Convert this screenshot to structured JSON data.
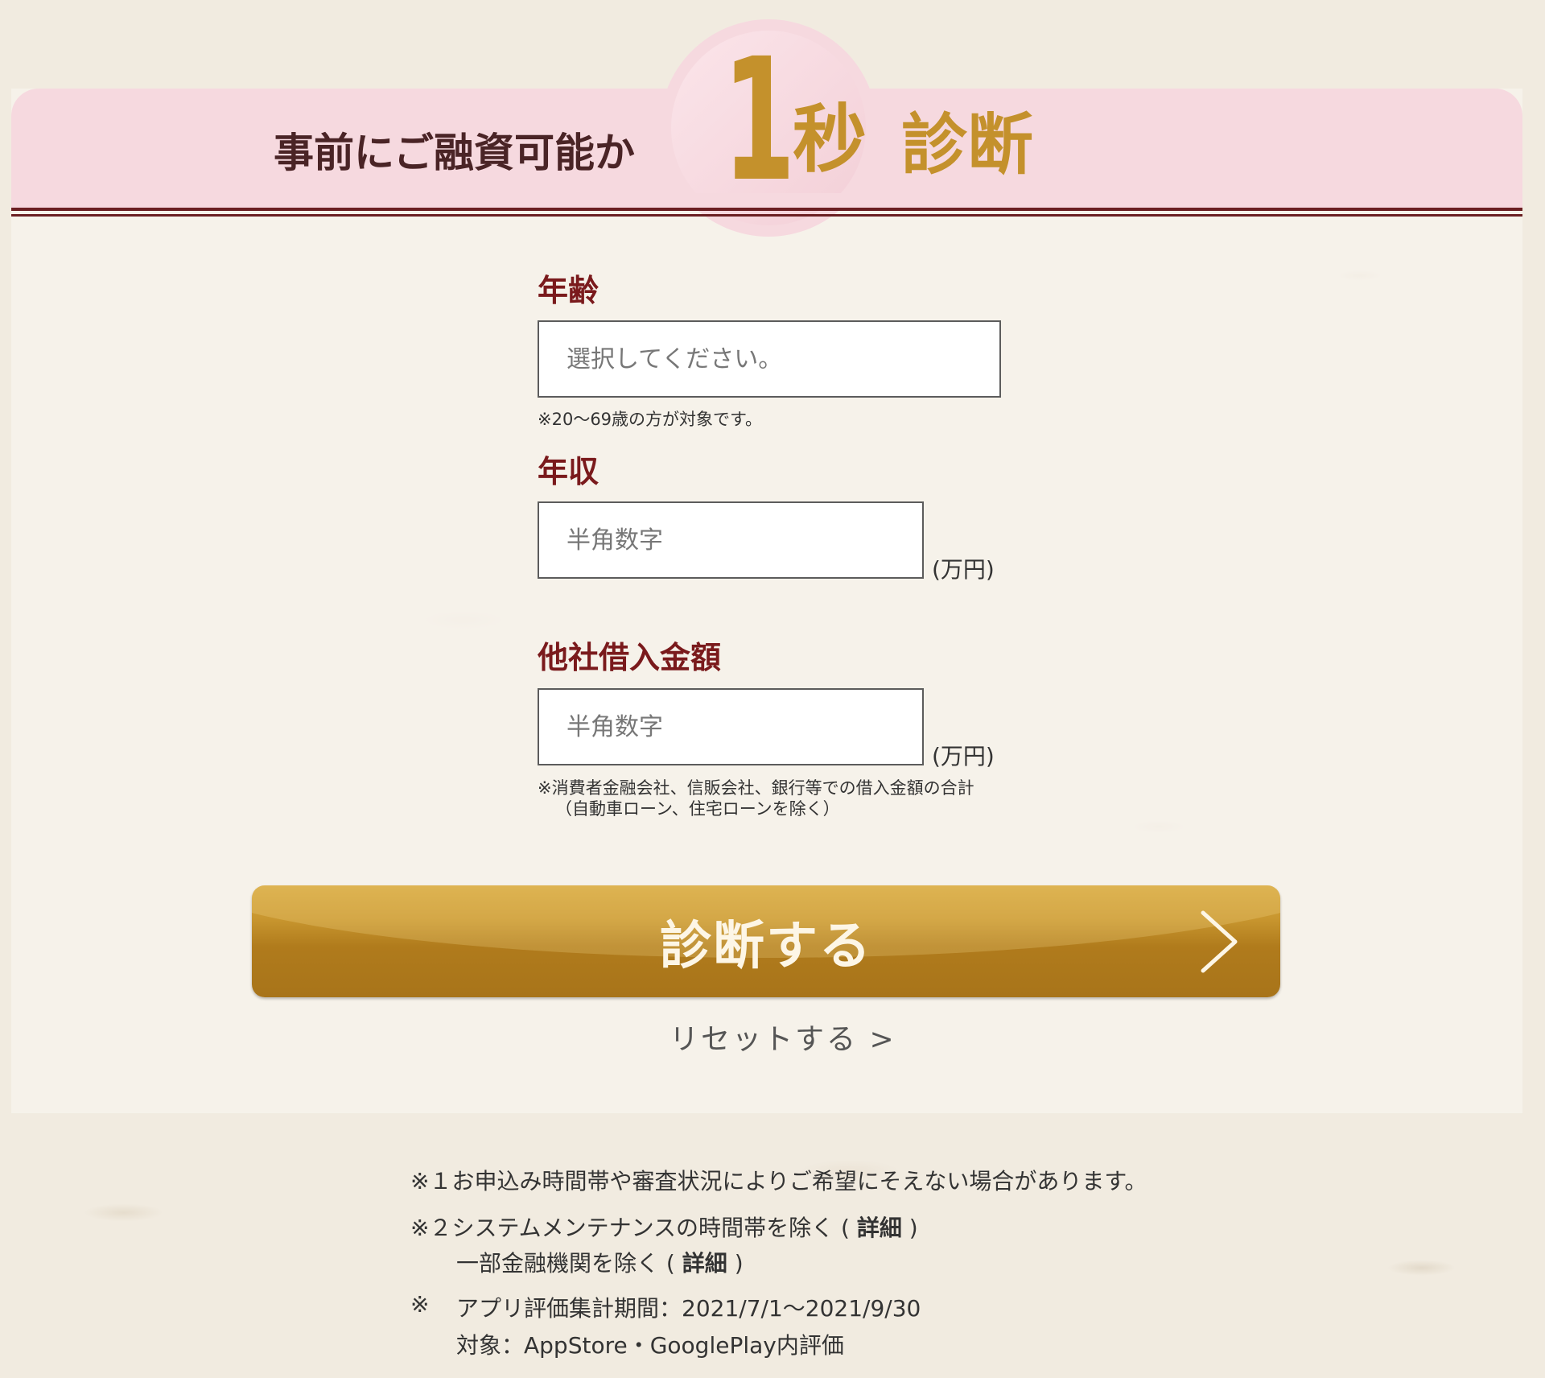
{
  "header": {
    "pre_text": "事前にご融資可能か",
    "one": "1",
    "byo": "秒",
    "shindan": "診断"
  },
  "form": {
    "age": {
      "label": "年齢",
      "placeholder": "選択してください。",
      "note": "※20〜69歳の方が対象です。"
    },
    "income": {
      "label": "年収",
      "placeholder": "半角数字",
      "unit": "(万円)"
    },
    "other_debt": {
      "label": "他社借入金額",
      "placeholder": "半角数字",
      "unit": "(万円)",
      "note_line1": "※消費者金融会社、信販会社、銀行等での借入金額の合計",
      "note_line2": "（自動車ローン、住宅ローンを除く）"
    },
    "submit_label": "診断する",
    "reset_label": "リセットする >"
  },
  "footnotes": {
    "fn1": "※１お申込み時間帯や審査状況によりご希望にそえない場合があります。",
    "fn2_prefix": "※２システムメンテナンスの時間帯を除く",
    "fn2_open": "(",
    "fn2_link": "詳細",
    "fn2_close": ")",
    "fn2b_prefix": "一部金融機関を除く",
    "fn2b_open": "(",
    "fn2b_link": "詳細",
    "fn2b_close": ")",
    "fn3_mark": "※",
    "fn3_line1": "アプリ評価集計期間：2021/7/1〜2021/9/30",
    "fn3_line2": "対象：AppStore・GooglePlay内評価"
  },
  "colors": {
    "header_pink": "#f6d9df",
    "accent_gold": "#c4912c",
    "label_maroon": "#7a1a1c",
    "rule_maroon": "#6b1f22"
  },
  "icons": {
    "submit": "chevron-right-icon"
  }
}
